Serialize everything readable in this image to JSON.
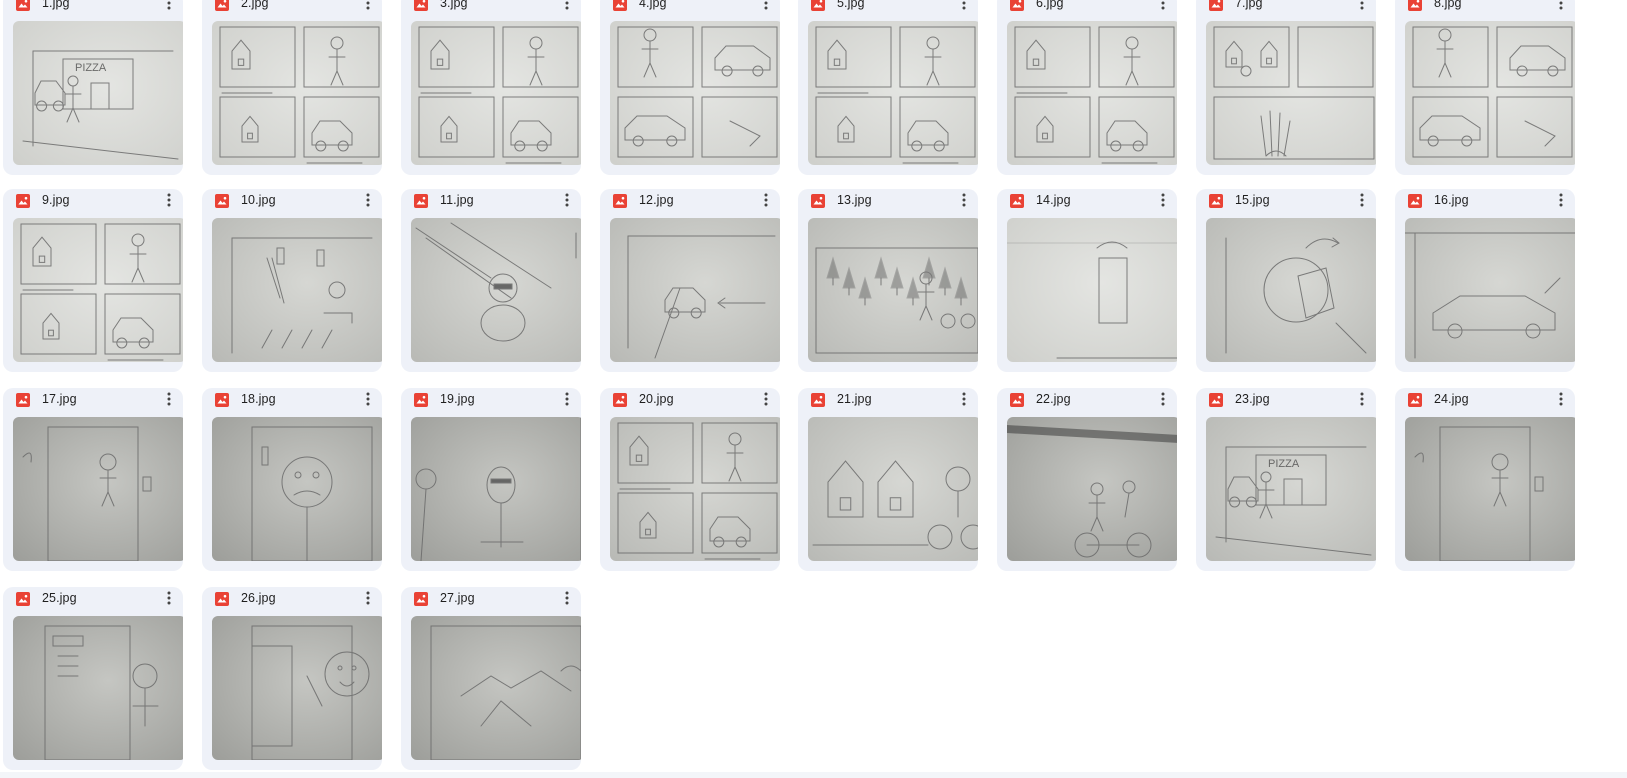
{
  "colors": {
    "card_bg": "#eef1f8",
    "image_icon_red": "#e94235",
    "paper_light": "#e8e8e6",
    "paper_dark": "#9a9a98",
    "pencil": "#6e6e6e",
    "text": "#1f1f1f"
  },
  "file_icon": "image-file-icon",
  "menu_icon": "more-vert-icon",
  "files": [
    {
      "name": "1.jpg",
      "paper": "light",
      "sketch": "pizza-shop"
    },
    {
      "name": "2.jpg",
      "paper": "light",
      "sketch": "panels"
    },
    {
      "name": "3.jpg",
      "paper": "light",
      "sketch": "panels"
    },
    {
      "name": "4.jpg",
      "paper": "light",
      "sketch": "panels-car"
    },
    {
      "name": "5.jpg",
      "paper": "light",
      "sketch": "panels"
    },
    {
      "name": "6.jpg",
      "paper": "light",
      "sketch": "panels"
    },
    {
      "name": "7.jpg",
      "paper": "light",
      "sketch": "panels-hand"
    },
    {
      "name": "8.jpg",
      "paper": "light",
      "sketch": "panels-car"
    },
    {
      "name": "9.jpg",
      "paper": "light",
      "sketch": "panels"
    },
    {
      "name": "10.jpg",
      "paper": "mid",
      "sketch": "traffic-lights"
    },
    {
      "name": "11.jpg",
      "paper": "mid",
      "sketch": "driver"
    },
    {
      "name": "12.jpg",
      "paper": "mid",
      "sketch": "car-arrow"
    },
    {
      "name": "13.jpg",
      "paper": "mid",
      "sketch": "forest"
    },
    {
      "name": "14.jpg",
      "paper": "light",
      "sketch": "box"
    },
    {
      "name": "15.jpg",
      "paper": "mid",
      "sketch": "circle-arrow"
    },
    {
      "name": "16.jpg",
      "paper": "mid",
      "sketch": "car-large"
    },
    {
      "name": "17.jpg",
      "paper": "dark",
      "sketch": "door-person"
    },
    {
      "name": "18.jpg",
      "paper": "dark",
      "sketch": "face-door"
    },
    {
      "name": "19.jpg",
      "paper": "dark",
      "sketch": "two-people"
    },
    {
      "name": "20.jpg",
      "paper": "mid",
      "sketch": "panels"
    },
    {
      "name": "21.jpg",
      "paper": "mid",
      "sketch": "houses-bike"
    },
    {
      "name": "22.jpg",
      "paper": "dark",
      "sketch": "bike-ride"
    },
    {
      "name": "23.jpg",
      "paper": "mid",
      "sketch": "pizza-shop"
    },
    {
      "name": "24.jpg",
      "paper": "dark",
      "sketch": "door-person"
    },
    {
      "name": "25.jpg",
      "paper": "dark",
      "sketch": "menu-person"
    },
    {
      "name": "26.jpg",
      "paper": "dark",
      "sketch": "menu-face"
    },
    {
      "name": "27.jpg",
      "paper": "dark",
      "sketch": "mountains"
    }
  ]
}
